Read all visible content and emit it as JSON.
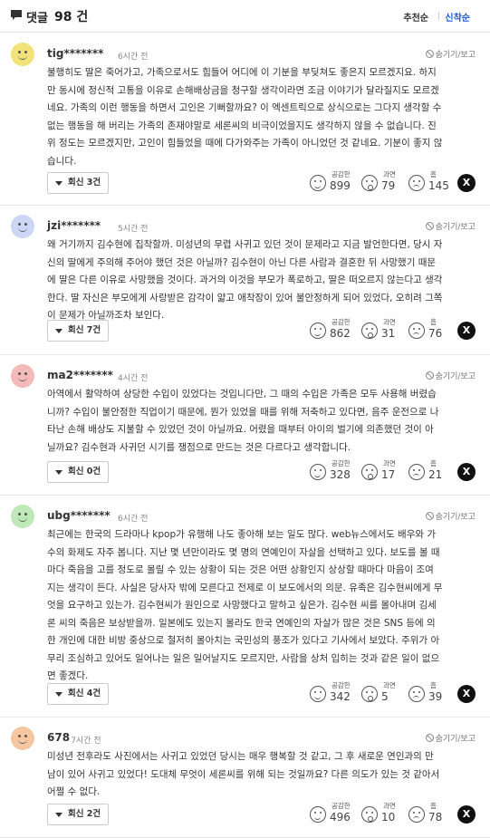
{
  "header": {
    "title": "댓글",
    "count": "98 건",
    "sort_recommended": "추천순",
    "sort_latest": "신착순"
  },
  "reaction_labels": {
    "empathy": "공감한",
    "excessive": "과연",
    "hmm": "흠"
  },
  "comments": [
    {
      "avatar_color": "#f2e27a",
      "author": "tig*******",
      "time": "6시간 전",
      "hide_label": "숨기기/보고",
      "body": "불행히도 딸은 죽어가고, 가족으로서도 힘들어 어디에 이 기분을 부딪쳐도 좋은지 모르겠지요. 하지\n만 동시에 정신적 고통을 이유로 손해배상금을 청구할 생각이라면 조금 이야기가 달라질지도 모르겠\n네요. 가족의 이런 행동을 하면서 고인은 기뻐할까요? 이 엑센트릭으로 상식으로는 그다지 생각할 수\n없는 행동을 해 버리는 가족의 존재야말로 세론씨의 비극이었을지도 생각하지 않을 수 없습니다. 진\n위 정도는 모르겠지만, 고인이 힘들었을 때에 다가와주는 가족이 아니었던 것 같네요. 기분이 좋지 않\n습니다.",
      "reply_label": "회신 3건",
      "empathy": "899",
      "excessive": "79",
      "hmm": "145",
      "x_label": "X"
    },
    {
      "avatar_color": "#cdd6f4",
      "author": "jzi*******",
      "time": "5시간 전",
      "hide_label": "숨기기/보고",
      "body": "왜 거기까지 김수현에 집착할까. 미성년의 무렵 사귀고 있던 것이 문제라고 지금 발언한다면, 당시 자\n신의 딸에게 주의해 주어야 했던 것은 아닐까? 김수현이 아닌 다른 사람과 결혼한 뒤 사망했기 때문\n에 딸은 다른 이유로 사망했을 것이다. 과거의 이것을 부모가 폭로하고, 딸은 떠오르지 않는다고 생각\n한다. 딸 자신은 부모에게 사랑받은 감각이 얇고 애착장이 있어 불안정하게 되어 있었다, 오히려 그쪽\n이 문제가 아닐까조차 보인다.",
      "reply_label": "회신 7건",
      "empathy": "862",
      "excessive": "31",
      "hmm": "76",
      "x_label": "X"
    },
    {
      "avatar_color": "#f4b9b9",
      "author": "ma2*******",
      "time": "4시간 전",
      "hide_label": "숨기기/보고",
      "body": "아역에서 활약하여 상당한 수입이 있었다는 것입니다만, 그 때의 수입은 가족은 모두 사용해 버렸습\n니까? 수입이 불안정한 직업이기 때문에, 뭔가 있었을 때를 위해 저축하고 있다면, 음주 운전으로 나\n타난 손해 배상도 지불할 수 있었던 것이 아닐까요. 어렸을 때부터 아이의 벌기에 의존했던 것이 아\n닐까요? 김수현과 사귀던 시기를 쟁점으로 만드는 것은 다르다고 생각합니다.",
      "reply_label": "회신 0건",
      "empathy": "328",
      "excessive": "17",
      "hmm": "21",
      "x_label": "X"
    },
    {
      "avatar_color": "#bfe8b8",
      "author": "ubg*******",
      "time": "6시간 전",
      "hide_label": "숨기기/보고",
      "body": "최근에는 한국의 드라마나 kpop가 유행해 나도 좋아해 보는 일도 많다. web뉴스에서도 배우와 가\n수의 화제도 자주 봅니다. 지난 몇 년만이라도 몇 명의 연예인이 자살을 선택하고 있다. 보도를 볼 때\n마다 죽음을 고를 정도로 몰릴 수 있는 상황이 되는 것은 어떤 상황인지 상상할 때마다 마음이 조여\n지는 생각이 든다. 사실은 당사자 밖에 모른다고 전제로 이 보도에서의 의문. 유족은 김수현씨에게 무\n엇을 요구하고 있는가. 김수현씨가 원인으로 사망했다고 말하고 싶은가. 김수현 씨를 몰아내며 김세\n론 씨의 죽음은 보상받을까. 일본에도 있는지 몰라도 한국 연예인의 자살가 많은 것은 SNS 등에 의\n한 개인에 대한 비방 중상으로 철저히 몰아치는 국민성의 풍조가 있다고 기사에서 보았다. 주위가 아\n무리 조심하고 있어도 일어나는 일은 일어날지도 모르지만, 사람을 상처 입히는 것과 같은 일이 없으\n면 좋겠다.",
      "reply_label": "회신 4건",
      "empathy": "342",
      "excessive": "5",
      "hmm": "39",
      "x_label": "X"
    },
    {
      "avatar_color": "#f6c6a0",
      "author": "678",
      "time": "7시간 전",
      "hide_label": "숨기기/보고",
      "body": "미성년 전후라도 사진에서는 사귀고 있었던 당시는 매우 행복할 것 같고, 그 후 새로운 연인과의 만\n남이 있어 사귀고 있었다! 도대체 무엇이 세론씨를 위해 되는 것일까요? 다른 의도가 있는 것 같아서\n어쩔 수 없다.",
      "reply_label": "회신 2건",
      "empathy": "496",
      "excessive": "10",
      "hmm": "78",
      "x_label": "X"
    }
  ]
}
